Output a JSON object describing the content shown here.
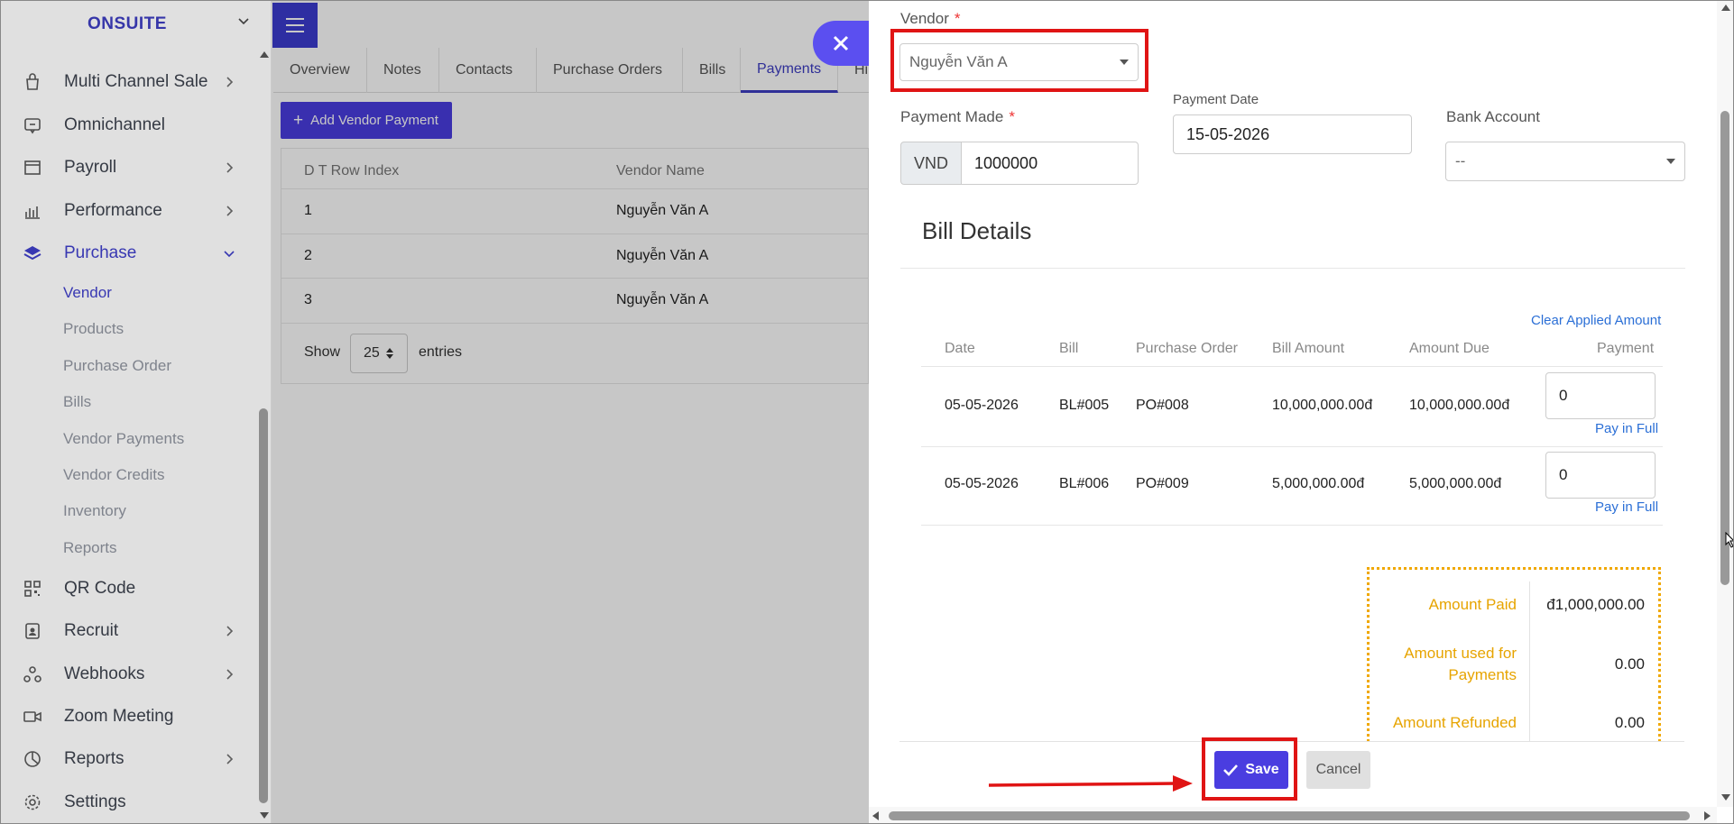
{
  "sidebar": {
    "brand": "ONSUITE",
    "items": [
      {
        "label": "Multi Channel Sale",
        "icon": "bag-icon"
      },
      {
        "label": "Omnichannel",
        "icon": "chat-screen-icon"
      },
      {
        "label": "Payroll",
        "icon": "window-icon"
      },
      {
        "label": "Performance",
        "icon": "bar-chart-icon"
      },
      {
        "label": "Purchase",
        "icon": "layers-icon"
      },
      {
        "label": "QR Code",
        "icon": "qr-code-icon"
      },
      {
        "label": "Recruit",
        "icon": "id-badge-icon"
      },
      {
        "label": "Webhooks",
        "icon": "webhooks-icon"
      },
      {
        "label": "Zoom Meeting",
        "icon": "video-camera-icon"
      },
      {
        "label": "Reports",
        "icon": "pie-chart-icon"
      },
      {
        "label": "Settings",
        "icon": "gear-icon"
      }
    ],
    "purchase_sub": [
      "Vendor",
      "Products",
      "Purchase Order",
      "Bills",
      "Vendor Payments",
      "Vendor Credits",
      "Inventory",
      "Reports"
    ]
  },
  "tabs": [
    "Overview",
    "Notes",
    "Contacts",
    "Purchase Orders",
    "Bills",
    "Payments",
    "Hi"
  ],
  "active_tab": "Payments",
  "add_button": "Add Vendor Payment",
  "table": {
    "headers": [
      "D T Row Index",
      "Vendor Name"
    ],
    "rows": [
      [
        "1",
        "Nguyễn Văn A"
      ],
      [
        "2",
        "Nguyễn Văn A"
      ],
      [
        "3",
        "Nguyễn Văn A"
      ]
    ],
    "show_label": "Show",
    "page_size": "25",
    "entries_label": "entries"
  },
  "form": {
    "vendor_label": "Vendor",
    "required_mark": "*",
    "vendor_value": "Nguyễn Văn A",
    "payment_made_label": "Payment Made",
    "currency": "VND",
    "payment_made_value": "1000000",
    "payment_date_label": "Payment Date",
    "payment_date_value": "15-05-2026",
    "bank_account_label": "Bank Account",
    "bank_account_value": "--"
  },
  "bill_details": {
    "title": "Bill Details",
    "clear_link": "Clear Applied Amount",
    "headers": [
      "Date",
      "Bill",
      "Purchase Order",
      "Bill Amount",
      "Amount Due",
      "Payment"
    ],
    "rows": [
      {
        "date": "05-05-2026",
        "bill": "BL#005",
        "po": "PO#008",
        "bill_amount": "10,000,000.00đ",
        "amount_due": "10,000,000.00đ",
        "payment": "0",
        "pay_full": "Pay in Full"
      },
      {
        "date": "05-05-2026",
        "bill": "BL#006",
        "po": "PO#009",
        "bill_amount": "5,000,000.00đ",
        "amount_due": "5,000,000.00đ",
        "payment": "0",
        "pay_full": "Pay in Full"
      }
    ]
  },
  "summary": {
    "amount_paid_label": "Amount Paid",
    "amount_paid": "đ1,000,000.00",
    "used_label_1": "Amount used for",
    "used_label_2": "Payments",
    "used_value": "0.00",
    "refunded_label": "Amount Refunded",
    "refunded_value": "0.00"
  },
  "actions": {
    "save": "Save",
    "cancel": "Cancel"
  },
  "colors": {
    "accent": "#4a3de0",
    "annotation": "#e01414",
    "summary_border": "#f0a800",
    "link": "#2b6fd6"
  }
}
